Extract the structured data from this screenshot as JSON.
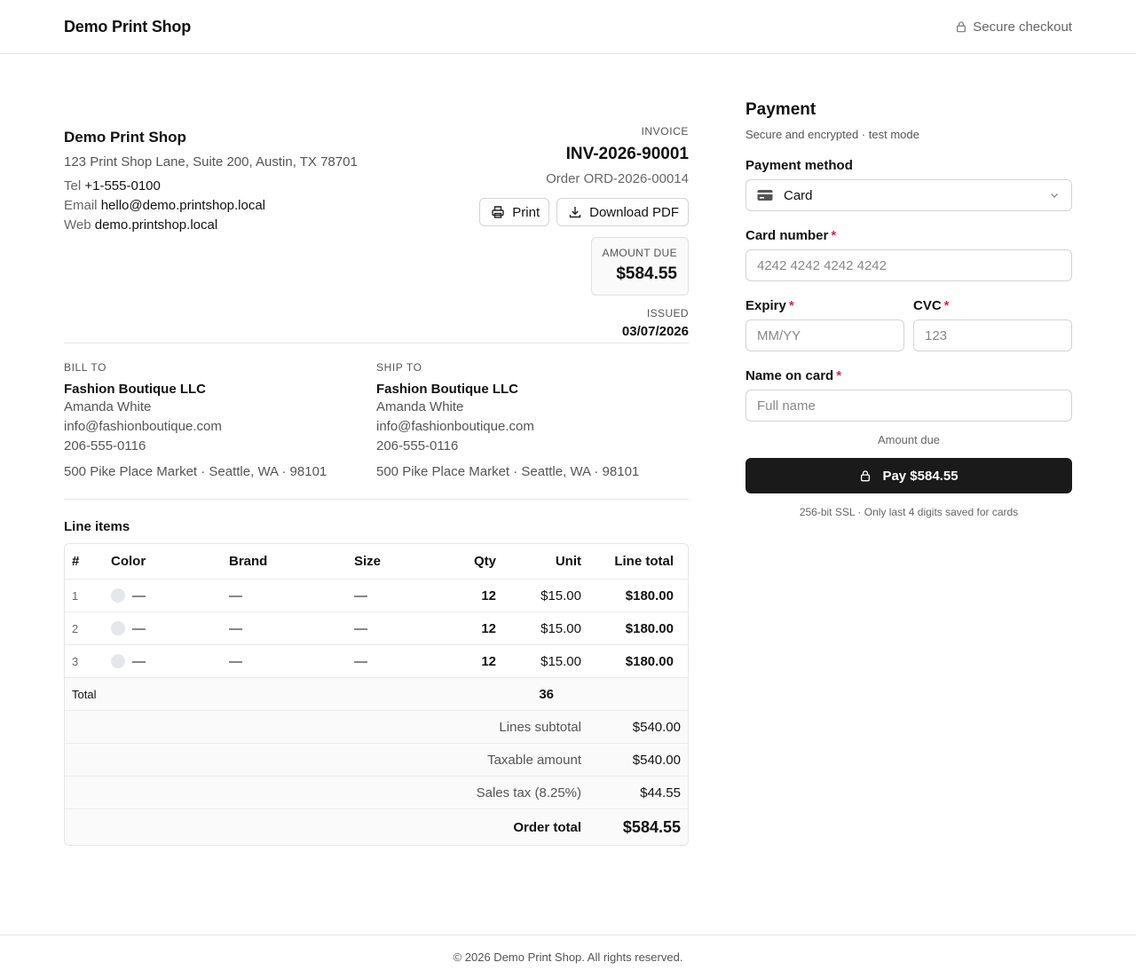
{
  "header": {
    "brand": "Demo Print Shop",
    "secure_label": "Secure checkout",
    "secure_icon": "lock-icon"
  },
  "shop": {
    "name": "Demo Print Shop",
    "address": "123 Print Shop Lane, Suite 200, Austin, TX 78701",
    "tel_label": "Tel",
    "tel": "+1-555-0100",
    "email_label": "Email",
    "email": "hello@demo.printshop.local",
    "web_label": "Web",
    "web": "demo.printshop.local"
  },
  "invoice": {
    "label": "INVOICE",
    "number": "INV-2026-90001",
    "order": "Order ORD-2026-00014",
    "print_label": "Print",
    "download_label": "Download PDF",
    "amount_due_label": "AMOUNT DUE",
    "amount_due": "$584.55",
    "issued_label": "ISSUED",
    "issued": "03/07/2026"
  },
  "bill_to": {
    "label": "BILL TO",
    "company": "Fashion Boutique LLC",
    "contact": "Amanda White",
    "email": "info@fashionboutique.com",
    "phone": "206-555-0116",
    "address": "500 Pike Place Market · Seattle, WA · 98101"
  },
  "ship_to": {
    "label": "SHIP TO",
    "company": "Fashion Boutique LLC",
    "contact": "Amanda White",
    "email": "info@fashionboutique.com",
    "phone": "206-555-0116",
    "address": "500 Pike Place Market · Seattle, WA · 98101"
  },
  "line_items": {
    "title": "Line items",
    "columns": [
      "#",
      "Color",
      "Brand",
      "Size",
      "Qty",
      "Unit",
      "Line total"
    ],
    "rows": [
      {
        "num": "1",
        "color": "—",
        "brand": "—",
        "size": "—",
        "qty": "12",
        "unit": "$15.00",
        "total": "$180.00"
      },
      {
        "num": "2",
        "color": "—",
        "brand": "—",
        "size": "—",
        "qty": "12",
        "unit": "$15.00",
        "total": "$180.00"
      },
      {
        "num": "3",
        "color": "—",
        "brand": "—",
        "size": "—",
        "qty": "12",
        "unit": "$15.00",
        "total": "$180.00"
      }
    ],
    "total_label": "Total",
    "total_qty": "36",
    "summary": [
      {
        "label": "Lines subtotal",
        "value": "$540.00"
      },
      {
        "label": "Taxable amount",
        "value": "$540.00"
      },
      {
        "label": "Sales tax (8.25%)",
        "value": "$44.55"
      }
    ],
    "order_total_label": "Order total",
    "order_total": "$584.55"
  },
  "payment": {
    "title": "Payment",
    "subtitle": "Secure and encrypted · test mode",
    "method_label": "Payment method",
    "method_value": "Card",
    "card_number_label": "Card number",
    "card_number_placeholder": "4242 4242 4242 4242",
    "expiry_label": "Expiry",
    "expiry_placeholder": "MM/YY",
    "cvc_label": "CVC",
    "cvc_placeholder": "123",
    "name_label": "Name on card",
    "name_placeholder": "Full name",
    "required_mark": "*",
    "amount_due_label": "Amount due",
    "pay_button": "Pay $584.55",
    "ssl_note": "256-bit SSL · Only last 4 digits saved for cards"
  },
  "footer": {
    "text": "© 2026 Demo Print Shop. All rights reserved."
  },
  "colors": {
    "accent": "#1a1a1a",
    "required": "#e11d48",
    "border": "#e5e5e5"
  }
}
